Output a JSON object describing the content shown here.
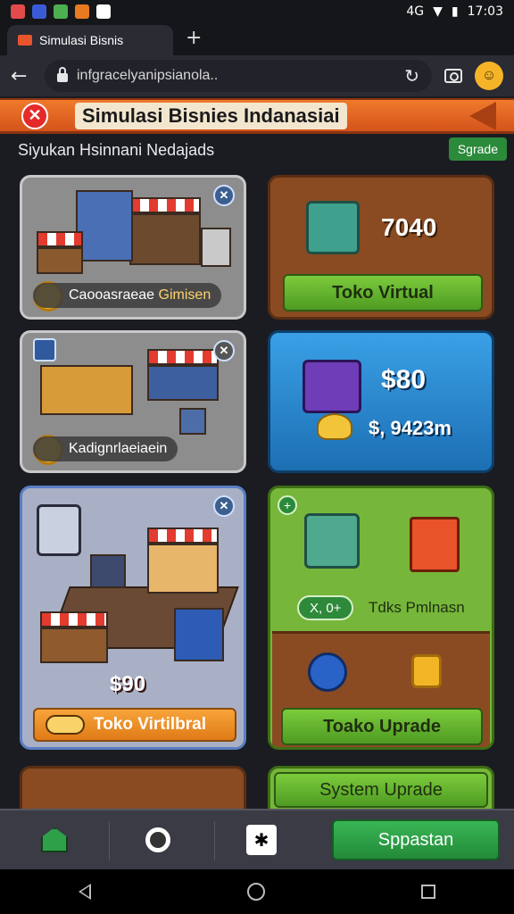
{
  "status_bar": {
    "time": "17:03",
    "signal_label": "4G",
    "icons": [
      "notification-icon",
      "app-icon",
      "app-icon",
      "app-icon",
      "app-icon"
    ]
  },
  "browser": {
    "tab_title": "Simulasi Bisnis",
    "new_tab_glyph": "+",
    "url": "infgracelyanipsianola..",
    "back_glyph": "←",
    "reload_glyph": "↻"
  },
  "banner": {
    "title": "Simulasi Bisnies Indanasiai",
    "close_glyph": "✕"
  },
  "subtitle": "Siyukan Hsinnani Nedajads",
  "upgrade_badge": "Sgrade",
  "cards": {
    "scene1": {
      "label_a": "Caooasraeae",
      "label_b": "Gimisen",
      "close_glyph": "✕"
    },
    "wood1": {
      "amount": "7040",
      "button": "Toko Virtual"
    },
    "scene2": {
      "label": "Kadignrlaeiaein",
      "close_glyph": "✕"
    },
    "blue1": {
      "amount": "$80",
      "subamount": "$, 9423m"
    },
    "scene3": {
      "price": "$90",
      "button": "Toko Virtilbral",
      "close_glyph": "✕"
    },
    "green1": {
      "pill": "X, 0+",
      "label": "Tdks Pmlnasn",
      "button": "Toako Uprade",
      "badge_glyph": "+"
    },
    "green2": {
      "button": "System Uprade"
    }
  },
  "toolbar": {
    "action_button": "Sppastan"
  },
  "colors": {
    "banner": "#e8632a",
    "accent_green": "#2c8a3b",
    "card_blue": "#2a86cf"
  }
}
